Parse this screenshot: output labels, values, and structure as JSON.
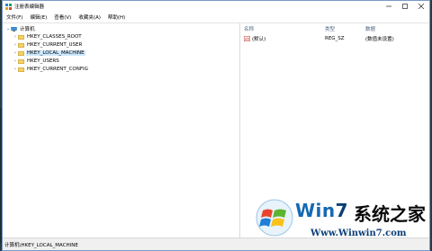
{
  "window": {
    "title": "注册表编辑器"
  },
  "menu": [
    {
      "label": "文件(F)"
    },
    {
      "label": "编辑(E)"
    },
    {
      "label": "查看(V)"
    },
    {
      "label": "收藏夹(A)"
    },
    {
      "label": "帮助(H)"
    }
  ],
  "tree": {
    "root": {
      "label": "计算机"
    },
    "items": [
      {
        "label": "HKEY_CLASSES_ROOT"
      },
      {
        "label": "HKEY_CURRENT_USER"
      },
      {
        "label": "HKEY_LOCAL_MACHINE"
      },
      {
        "label": "HKEY_USERS"
      },
      {
        "label": "HKEY_CURRENT_CONFIG"
      }
    ],
    "selected_index": 2
  },
  "list": {
    "columns": [
      "名称",
      "类型",
      "数据"
    ],
    "rows": [
      {
        "name": "(默认)",
        "type": "REG_SZ",
        "data": "(数值未设置)"
      }
    ]
  },
  "status": {
    "path": "计算机\\HKEY_LOCAL_MACHINE"
  },
  "watermark": {
    "brand_a": "Win",
    "brand_b": "7",
    "brand_cn": "系统之家",
    "url": "Www.Winwin7.com"
  },
  "colors": {
    "selection": "#cce8ff",
    "folder": "#f3d26a",
    "brand_blue": "#1569b3"
  }
}
